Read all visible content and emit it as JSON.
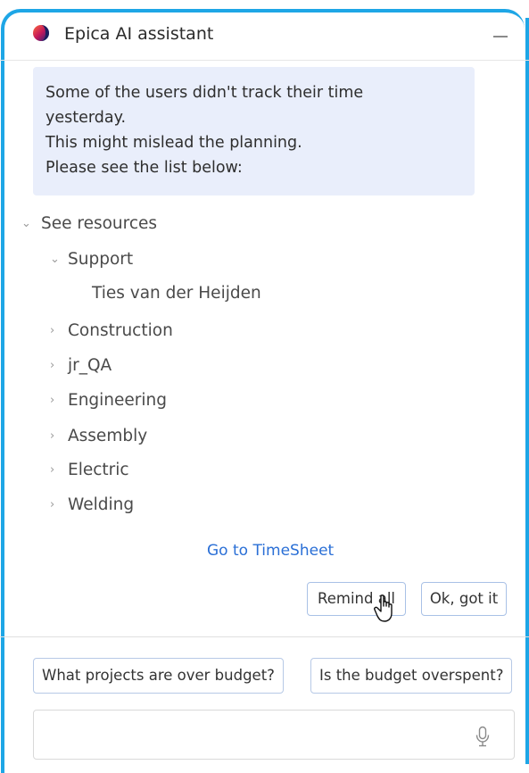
{
  "header": {
    "title": "Epica AI assistant",
    "logo_icon": "epica-logo-icon",
    "minimize_icon": "minimize-icon"
  },
  "message": {
    "lines": [
      "Some of the users didn't track their time",
      "yesterday.",
      "This might mislead the planning.",
      "Please see the list below:"
    ]
  },
  "tree": {
    "root": {
      "label": "See resources",
      "expanded": true
    },
    "groups": [
      {
        "label": "Support",
        "expanded": true,
        "children": [
          "Ties van der Heijden"
        ]
      },
      {
        "label": "Construction",
        "expanded": false
      },
      {
        "label": "jr_QA",
        "expanded": false
      },
      {
        "label": "Engineering",
        "expanded": false
      },
      {
        "label": "Assembly",
        "expanded": false
      },
      {
        "label": "Electric",
        "expanded": false
      },
      {
        "label": "Welding",
        "expanded": false
      }
    ]
  },
  "link": {
    "label": "Go to TimeSheet"
  },
  "actions": {
    "remind_all": "Remind all",
    "ok_got_it": "Ok, got it"
  },
  "suggestions": [
    "What projects are over budget?",
    "Is the budget overspent?"
  ],
  "input": {
    "value": "",
    "placeholder": "",
    "mic_icon": "microphone-icon"
  },
  "colors": {
    "accent_border": "#1ea6e6",
    "message_bg": "#e9eefb",
    "link": "#2a6fd6",
    "button_border": "#a9c1e6"
  }
}
